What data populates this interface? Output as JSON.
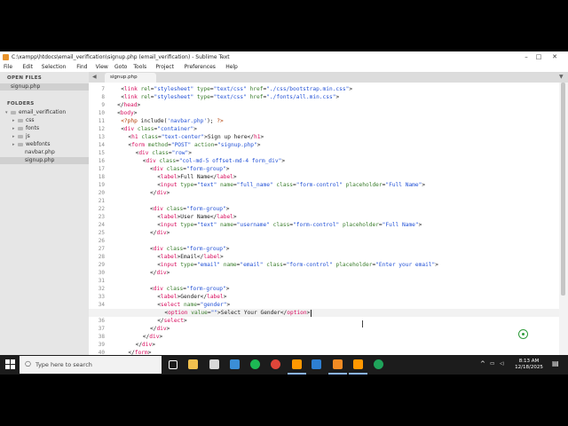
{
  "window": {
    "title": "C:\\xampp\\htdocs\\email_verification\\signup.php (email_verification) - Sublime Text",
    "controls": [
      "minimize-icon",
      "maximize-icon",
      "close-icon"
    ]
  },
  "menu": [
    "File",
    "Edit",
    "Selection",
    "Find",
    "View",
    "Goto",
    "Tools",
    "Project",
    "Preferences",
    "Help"
  ],
  "sidebar": {
    "open_files_label": "OPEN FILES",
    "open_files": [
      {
        "label": "signup.php",
        "selected": true
      }
    ],
    "folders_label": "FOLDERS",
    "root": "email_verification",
    "items": [
      {
        "label": "css",
        "type": "folder"
      },
      {
        "label": "fonts",
        "type": "folder"
      },
      {
        "label": "js",
        "type": "folder"
      },
      {
        "label": "webfonts",
        "type": "folder"
      },
      {
        "label": "navbar.php",
        "type": "file"
      },
      {
        "label": "signup.php",
        "type": "file",
        "selected": true
      }
    ]
  },
  "tab": {
    "label": "signup.php",
    "active": true
  },
  "editor": {
    "current_line": 35,
    "lines": [
      {
        "n": 7,
        "indent": 2,
        "tokens": [
          [
            "<",
            "p"
          ],
          [
            "link",
            "t"
          ],
          [
            " ",
            "p"
          ],
          [
            "rel",
            "a"
          ],
          [
            "=",
            "p"
          ],
          [
            "\"stylesheet\"",
            "s"
          ],
          [
            " ",
            "p"
          ],
          [
            "type",
            "a"
          ],
          [
            "=",
            "p"
          ],
          [
            "\"text/css\"",
            "s"
          ],
          [
            " ",
            "p"
          ],
          [
            "href",
            "a"
          ],
          [
            "=",
            "p"
          ],
          [
            "\"./css/bootstrap.min.css\"",
            "s"
          ],
          [
            ">",
            "p"
          ]
        ]
      },
      {
        "n": 8,
        "indent": 2,
        "tokens": [
          [
            "<",
            "p"
          ],
          [
            "link",
            "t"
          ],
          [
            " ",
            "p"
          ],
          [
            "rel",
            "a"
          ],
          [
            "=",
            "p"
          ],
          [
            "\"stylesheet\"",
            "s"
          ],
          [
            " ",
            "p"
          ],
          [
            "type",
            "a"
          ],
          [
            "=",
            "p"
          ],
          [
            "\"text/css\"",
            "s"
          ],
          [
            " ",
            "p"
          ],
          [
            "href",
            "a"
          ],
          [
            "=",
            "p"
          ],
          [
            "\"./fonts/all.min.css\"",
            "s"
          ],
          [
            ">",
            "p"
          ]
        ]
      },
      {
        "n": 9,
        "indent": 1,
        "tokens": [
          [
            "</",
            "p"
          ],
          [
            "head",
            "t"
          ],
          [
            ">",
            "p"
          ]
        ]
      },
      {
        "n": 10,
        "indent": 1,
        "tokens": [
          [
            "<",
            "p"
          ],
          [
            "body",
            "t"
          ],
          [
            ">",
            "p"
          ]
        ]
      },
      {
        "n": 11,
        "indent": 2,
        "tokens": [
          [
            "<?php",
            "k"
          ],
          [
            " include(",
            "p"
          ],
          [
            "'navbar.php'",
            "s"
          ],
          [
            "); ",
            "p"
          ],
          [
            "?>",
            "k"
          ]
        ]
      },
      {
        "n": 12,
        "indent": 2,
        "tokens": [
          [
            "<",
            "p"
          ],
          [
            "div",
            "t"
          ],
          [
            " ",
            "p"
          ],
          [
            "class",
            "a"
          ],
          [
            "=",
            "p"
          ],
          [
            "\"container\"",
            "s"
          ],
          [
            ">",
            "p"
          ]
        ]
      },
      {
        "n": 13,
        "indent": 4,
        "tokens": [
          [
            "<",
            "p"
          ],
          [
            "h1",
            "t"
          ],
          [
            " ",
            "p"
          ],
          [
            "class",
            "a"
          ],
          [
            "=",
            "p"
          ],
          [
            "\"text-center\"",
            "s"
          ],
          [
            ">Sign up here</",
            "p"
          ],
          [
            "h1",
            "t"
          ],
          [
            ">",
            "p"
          ]
        ]
      },
      {
        "n": 14,
        "indent": 4,
        "tokens": [
          [
            "<",
            "p"
          ],
          [
            "form",
            "t"
          ],
          [
            " ",
            "p"
          ],
          [
            "method",
            "a"
          ],
          [
            "=",
            "p"
          ],
          [
            "\"POST\"",
            "s"
          ],
          [
            " ",
            "p"
          ],
          [
            "action",
            "a"
          ],
          [
            "=",
            "p"
          ],
          [
            "\"signup.php\"",
            "s"
          ],
          [
            ">",
            "p"
          ]
        ]
      },
      {
        "n": 15,
        "indent": 6,
        "tokens": [
          [
            "<",
            "p"
          ],
          [
            "div",
            "t"
          ],
          [
            " ",
            "p"
          ],
          [
            "class",
            "a"
          ],
          [
            "=",
            "p"
          ],
          [
            "\"row\"",
            "s"
          ],
          [
            ">",
            "p"
          ]
        ]
      },
      {
        "n": 16,
        "indent": 8,
        "tokens": [
          [
            "<",
            "p"
          ],
          [
            "div",
            "t"
          ],
          [
            " ",
            "p"
          ],
          [
            "class",
            "a"
          ],
          [
            "=",
            "p"
          ],
          [
            "\"col-md-5 offset-md-4 form_div\"",
            "s"
          ],
          [
            ">",
            "p"
          ]
        ]
      },
      {
        "n": 17,
        "indent": 10,
        "tokens": [
          [
            "<",
            "p"
          ],
          [
            "div",
            "t"
          ],
          [
            " ",
            "p"
          ],
          [
            "class",
            "a"
          ],
          [
            "=",
            "p"
          ],
          [
            "\"form-group\"",
            "s"
          ],
          [
            ">",
            "p"
          ]
        ]
      },
      {
        "n": 18,
        "indent": 12,
        "tokens": [
          [
            "<",
            "p"
          ],
          [
            "label",
            "t"
          ],
          [
            ">Full Name</",
            "p"
          ],
          [
            "label",
            "t"
          ],
          [
            ">",
            "p"
          ]
        ]
      },
      {
        "n": 19,
        "indent": 12,
        "tokens": [
          [
            "<",
            "p"
          ],
          [
            "input",
            "t"
          ],
          [
            " ",
            "p"
          ],
          [
            "type",
            "a"
          ],
          [
            "=",
            "p"
          ],
          [
            "\"text\"",
            "s"
          ],
          [
            " ",
            "p"
          ],
          [
            "name",
            "a"
          ],
          [
            "=",
            "p"
          ],
          [
            "\"full_name\"",
            "s"
          ],
          [
            " ",
            "p"
          ],
          [
            "class",
            "a"
          ],
          [
            "=",
            "p"
          ],
          [
            "\"form-control\"",
            "s"
          ],
          [
            " ",
            "p"
          ],
          [
            "placeholder",
            "a"
          ],
          [
            "=",
            "p"
          ],
          [
            "\"Full Name\"",
            "s"
          ],
          [
            ">",
            "p"
          ]
        ]
      },
      {
        "n": 20,
        "indent": 10,
        "tokens": [
          [
            "</",
            "p"
          ],
          [
            "div",
            "t"
          ],
          [
            ">",
            "p"
          ]
        ]
      },
      {
        "n": 21,
        "indent": 0,
        "tokens": []
      },
      {
        "n": 22,
        "indent": 10,
        "tokens": [
          [
            "<",
            "p"
          ],
          [
            "div",
            "t"
          ],
          [
            " ",
            "p"
          ],
          [
            "class",
            "a"
          ],
          [
            "=",
            "p"
          ],
          [
            "\"form-group\"",
            "s"
          ],
          [
            ">",
            "p"
          ]
        ]
      },
      {
        "n": 23,
        "indent": 12,
        "tokens": [
          [
            "<",
            "p"
          ],
          [
            "label",
            "t"
          ],
          [
            ">User Name</",
            "p"
          ],
          [
            "label",
            "t"
          ],
          [
            ">",
            "p"
          ]
        ]
      },
      {
        "n": 24,
        "indent": 12,
        "tokens": [
          [
            "<",
            "p"
          ],
          [
            "input",
            "t"
          ],
          [
            " ",
            "p"
          ],
          [
            "type",
            "a"
          ],
          [
            "=",
            "p"
          ],
          [
            "\"text\"",
            "s"
          ],
          [
            " ",
            "p"
          ],
          [
            "name",
            "a"
          ],
          [
            "=",
            "p"
          ],
          [
            "\"username\"",
            "s"
          ],
          [
            " ",
            "p"
          ],
          [
            "class",
            "a"
          ],
          [
            "=",
            "p"
          ],
          [
            "\"form-control\"",
            "s"
          ],
          [
            " ",
            "p"
          ],
          [
            "placeholder",
            "a"
          ],
          [
            "=",
            "p"
          ],
          [
            "\"Full Name\"",
            "s"
          ],
          [
            ">",
            "p"
          ]
        ]
      },
      {
        "n": 25,
        "indent": 10,
        "tokens": [
          [
            "</",
            "p"
          ],
          [
            "div",
            "t"
          ],
          [
            ">",
            "p"
          ]
        ]
      },
      {
        "n": 26,
        "indent": 0,
        "tokens": []
      },
      {
        "n": 27,
        "indent": 10,
        "tokens": [
          [
            "<",
            "p"
          ],
          [
            "div",
            "t"
          ],
          [
            " ",
            "p"
          ],
          [
            "class",
            "a"
          ],
          [
            "=",
            "p"
          ],
          [
            "\"form-group\"",
            "s"
          ],
          [
            ">",
            "p"
          ]
        ]
      },
      {
        "n": 28,
        "indent": 12,
        "tokens": [
          [
            "<",
            "p"
          ],
          [
            "label",
            "t"
          ],
          [
            ">Email</",
            "p"
          ],
          [
            "label",
            "t"
          ],
          [
            ">",
            "p"
          ]
        ]
      },
      {
        "n": 29,
        "indent": 12,
        "tokens": [
          [
            "<",
            "p"
          ],
          [
            "input",
            "t"
          ],
          [
            " ",
            "p"
          ],
          [
            "type",
            "a"
          ],
          [
            "=",
            "p"
          ],
          [
            "\"email\"",
            "s"
          ],
          [
            " ",
            "p"
          ],
          [
            "name",
            "a"
          ],
          [
            "=",
            "p"
          ],
          [
            "\"email\"",
            "s"
          ],
          [
            " ",
            "p"
          ],
          [
            "class",
            "a"
          ],
          [
            "=",
            "p"
          ],
          [
            "\"form-control\"",
            "s"
          ],
          [
            " ",
            "p"
          ],
          [
            "placeholder",
            "a"
          ],
          [
            "=",
            "p"
          ],
          [
            "\"Enter your email\"",
            "s"
          ],
          [
            ">",
            "p"
          ]
        ]
      },
      {
        "n": 30,
        "indent": 10,
        "tokens": [
          [
            "</",
            "p"
          ],
          [
            "div",
            "t"
          ],
          [
            ">",
            "p"
          ]
        ]
      },
      {
        "n": 31,
        "indent": 0,
        "tokens": []
      },
      {
        "n": 32,
        "indent": 10,
        "tokens": [
          [
            "<",
            "p"
          ],
          [
            "div",
            "t"
          ],
          [
            " ",
            "p"
          ],
          [
            "class",
            "a"
          ],
          [
            "=",
            "p"
          ],
          [
            "\"form-group\"",
            "s"
          ],
          [
            ">",
            "p"
          ]
        ]
      },
      {
        "n": 33,
        "indent": 12,
        "tokens": [
          [
            "<",
            "p"
          ],
          [
            "label",
            "t"
          ],
          [
            ">Gender</",
            "p"
          ],
          [
            "label",
            "t"
          ],
          [
            ">",
            "p"
          ]
        ]
      },
      {
        "n": 34,
        "indent": 12,
        "tokens": [
          [
            "<",
            "p"
          ],
          [
            "select",
            "t"
          ],
          [
            " ",
            "p"
          ],
          [
            "name",
            "a"
          ],
          [
            "=",
            "p"
          ],
          [
            "\"gender\"",
            "s"
          ],
          [
            ">",
            "p"
          ]
        ]
      },
      {
        "n": 35,
        "indent": 14,
        "tokens": [
          [
            "<",
            "p"
          ],
          [
            "option",
            "t"
          ],
          [
            " ",
            "p"
          ],
          [
            "value",
            "a"
          ],
          [
            "=",
            "p"
          ],
          [
            "\"\"",
            "s"
          ],
          [
            ">Select Your Gender</",
            "p"
          ],
          [
            "option",
            "t"
          ],
          [
            ">",
            "p"
          ]
        ]
      },
      {
        "n": 36,
        "indent": 12,
        "tokens": [
          [
            "</",
            "p"
          ],
          [
            "select",
            "t"
          ],
          [
            ">",
            "p"
          ]
        ]
      },
      {
        "n": 37,
        "indent": 10,
        "tokens": [
          [
            "</",
            "p"
          ],
          [
            "div",
            "t"
          ],
          [
            ">",
            "p"
          ]
        ]
      },
      {
        "n": 38,
        "indent": 8,
        "tokens": [
          [
            "</",
            "p"
          ],
          [
            "div",
            "t"
          ],
          [
            ">",
            "p"
          ]
        ]
      },
      {
        "n": 39,
        "indent": 6,
        "tokens": [
          [
            "</",
            "p"
          ],
          [
            "div",
            "t"
          ],
          [
            ">",
            "p"
          ]
        ]
      },
      {
        "n": 40,
        "indent": 4,
        "tokens": [
          [
            "</",
            "p"
          ],
          [
            "form",
            "t"
          ],
          [
            ">",
            "p"
          ]
        ]
      }
    ]
  },
  "colors": {
    "tag": "#d70a5c",
    "attr": "#3a7d2c",
    "string": "#2251d6",
    "keyword": "#b23b00",
    "plain": "#222222",
    "cursor_ring": "#2e9b3a"
  },
  "taskbar": {
    "search_placeholder": "Type here to search",
    "apps": [
      "task-view-icon",
      "file-explorer-icon",
      "store-icon",
      "photos-icon",
      "spotify-icon",
      "chrome-icon",
      "sublime-text-icon",
      "vscode-icon",
      "xampp-icon",
      "sublime-text-icon",
      "edge-icon"
    ],
    "time": "8:13 AM",
    "date": "12/18/2025"
  }
}
